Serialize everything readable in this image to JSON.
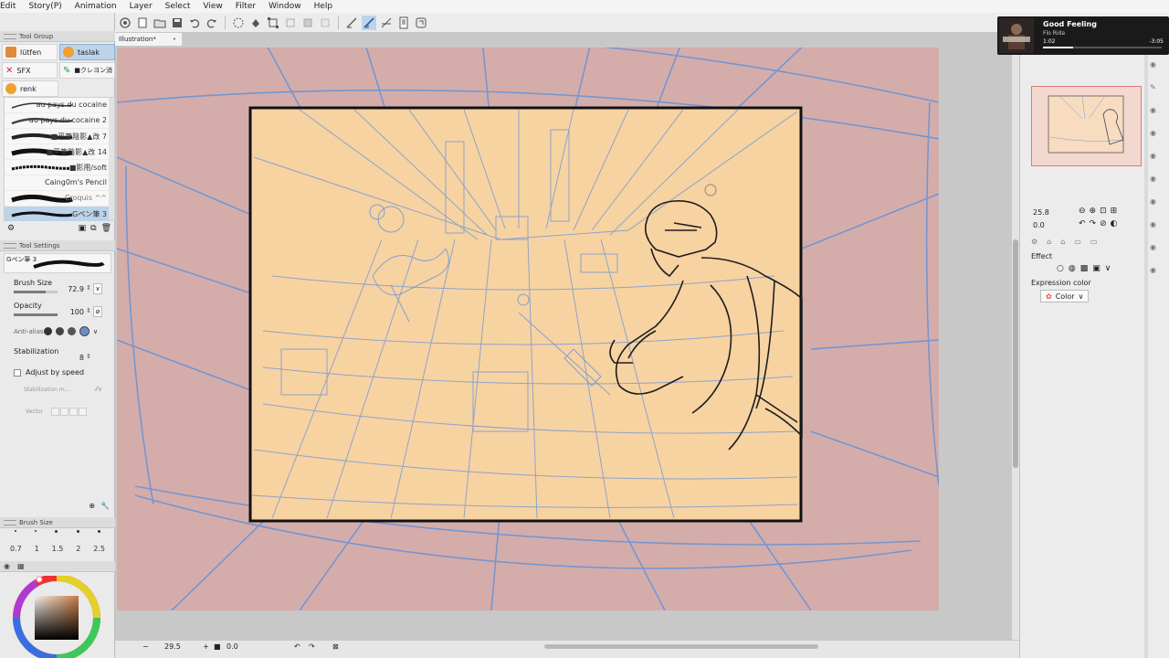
{
  "menu": [
    "Edit",
    "Story(P)",
    "Animation",
    "Layer",
    "Select",
    "View",
    "Filter",
    "Window",
    "Help"
  ],
  "tool_group": {
    "title": "Tool Group",
    "items": [
      {
        "label": "lütfen",
        "icon": "pencil-tool-icon",
        "color": "#e08a3c",
        "active": false
      },
      {
        "label": "taslak",
        "icon": "orange-ball-icon",
        "color": "#f0a030",
        "active": true
      },
      {
        "label": "SFX",
        "icon": "x-tool-icon",
        "color": "#c8323c",
        "active": false
      },
      {
        "label": "■クレヨン消",
        "icon": "eraser-tool-icon",
        "color": "#2a9a4a",
        "active": false
      },
      {
        "label": "renk",
        "icon": "orange-ball-icon",
        "color": "#f0a030",
        "active": false
      }
    ]
  },
  "brushes": [
    {
      "name": "au pays du cocaine",
      "selected": false
    },
    {
      "name": "au pays du cocaine 2",
      "selected": false
    },
    {
      "name": "■平筆陰影▲改 7",
      "selected": false
    },
    {
      "name": "■平筆陰影▲改 14",
      "selected": false
    },
    {
      "name": "■影用/soft",
      "selected": false
    },
    {
      "name": "Caing0m's Pencil",
      "selected": false
    },
    {
      "name": "Croquis ^^",
      "selected": false
    },
    {
      "name": "Gペン筆 3",
      "selected": true
    }
  ],
  "tool_settings": {
    "title": "Tool Settings",
    "preview_label": "Gペン筆 3",
    "brush_size_label": "Brush Size",
    "brush_size": "72.9",
    "brush_size_fill": 0.72,
    "opacity_label": "Opacity",
    "opacity": "100",
    "opacity_fill": 1.0,
    "antialias_label": "Anti-alias",
    "stabilization_label": "Stabilization",
    "stabilization": "8",
    "adjust_speed_label": "Adjust by speed",
    "stabilization_sub_label": "Stabilization m...",
    "vector_label": "Vector"
  },
  "brush_size_panel": {
    "title": "Brush Size",
    "values": [
      "0.7",
      "1",
      "1.5",
      "2",
      "2.5"
    ]
  },
  "canvas": {
    "tab_label": "Illustration*",
    "tab_close": "•"
  },
  "bottombar": {
    "zoom": "29.5",
    "angle": "0.0"
  },
  "media": {
    "title": "Good Feeling",
    "artist": "Flo Rida",
    "current": "1:02",
    "remaining": "-3:05",
    "progress": 0.25
  },
  "right_panel": {
    "zoom": "25.8",
    "angle": "0.0",
    "effect_label": "Effect",
    "expression_color_label": "Expression color",
    "expression_color_value": "Color"
  },
  "colors": {
    "paper": "#f7d3a2",
    "outside": "#d4adab",
    "blue_line": "#5b8fd8",
    "ink": "#1e1e1e",
    "accent": "#bcd3ea"
  }
}
